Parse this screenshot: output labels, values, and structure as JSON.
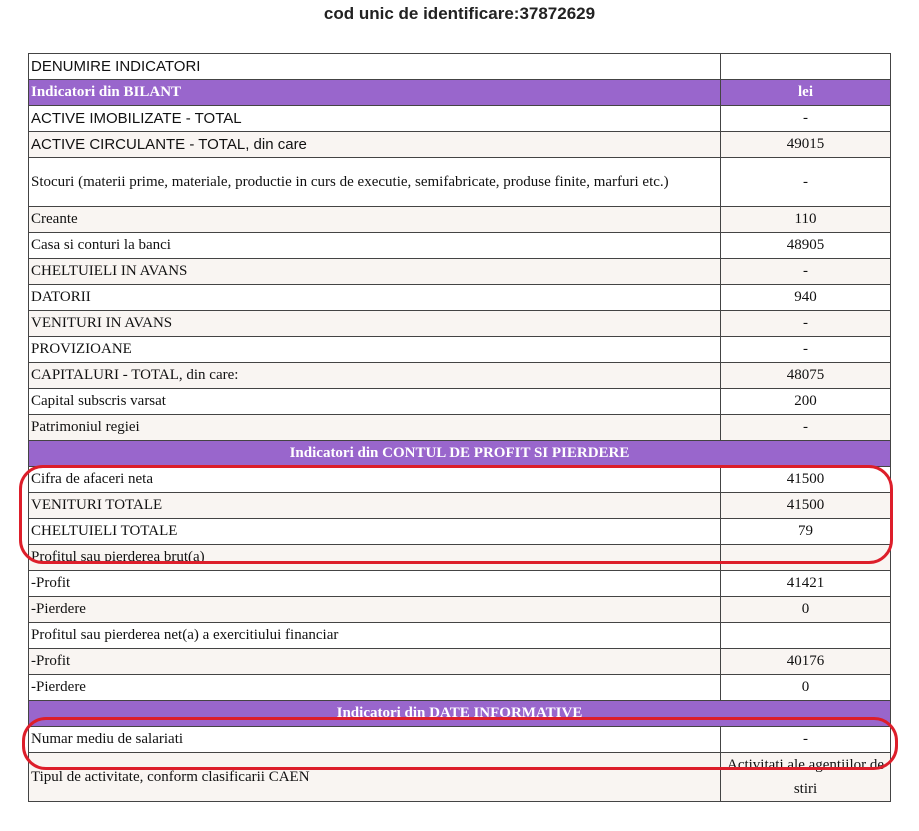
{
  "header": {
    "title": "cod unic de identificare:37872629"
  },
  "table": {
    "col1_header": "DENUMIRE INDICATORI",
    "col2_header": "",
    "bilant": {
      "title": "Indicatori din BILANT",
      "unit": "lei",
      "rows": [
        {
          "label": "ACTIVE IMOBILIZATE - TOTAL",
          "value": "-"
        },
        {
          "label": "ACTIVE CIRCULANTE - TOTAL, din care",
          "value": "49015"
        },
        {
          "label": "Stocuri (materii prime, materiale, productie in curs de executie, semifabricate, produse finite, marfuri etc.)",
          "value": "-"
        },
        {
          "label": "Creante",
          "value": "110"
        },
        {
          "label": "Casa si conturi la banci",
          "value": "48905"
        },
        {
          "label": "CHELTUIELI IN AVANS",
          "value": "-"
        },
        {
          "label": "DATORII",
          "value": "940"
        },
        {
          "label": "VENITURI IN AVANS",
          "value": "-"
        },
        {
          "label": "PROVIZIOANE",
          "value": "-"
        },
        {
          "label": "CAPITALURI - TOTAL, din care:",
          "value": "48075"
        },
        {
          "label": "Capital subscris varsat",
          "value": "200"
        },
        {
          "label": "Patrimoniul regiei",
          "value": "-"
        }
      ]
    },
    "profit": {
      "title": "Indicatori din CONTUL DE PROFIT SI PIERDERE",
      "rows": [
        {
          "label": "Cifra de afaceri neta",
          "value": "41500"
        },
        {
          "label": "VENITURI TOTALE",
          "value": "41500"
        },
        {
          "label": "CHELTUIELI TOTALE",
          "value": "79"
        },
        {
          "label": "Profitul sau pierderea brut(a)",
          "value": ""
        },
        {
          "label": "-Profit",
          "value": "41421"
        },
        {
          "label": "-Pierdere",
          "value": "0"
        },
        {
          "label": "Profitul sau pierderea net(a) a exercitiului financiar",
          "value": ""
        },
        {
          "label": "-Profit",
          "value": "40176"
        },
        {
          "label": "-Pierdere",
          "value": "0"
        }
      ]
    },
    "informative": {
      "title": "Indicatori din DATE INFORMATIVE",
      "rows": [
        {
          "label": "Numar mediu de salariati",
          "value": "-"
        },
        {
          "label": "Tipul de activitate, conform clasificarii CAEN",
          "value": "Activitati ale agentiilor de stiri"
        }
      ]
    }
  },
  "annotations": {
    "highlight_color": "#dd1e2a",
    "section_color": "#9966cc"
  }
}
